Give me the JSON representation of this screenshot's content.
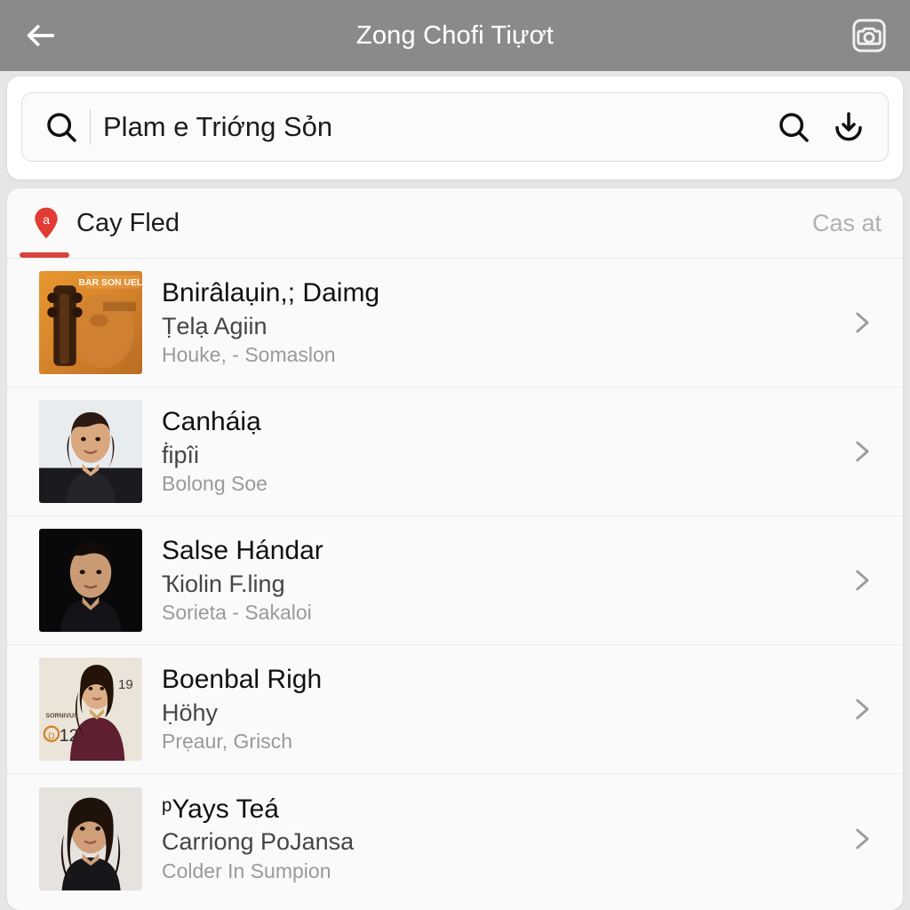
{
  "appbar": {
    "title": "Zong Chofi Tiựơt",
    "back_icon": "arrow-left-icon",
    "camera_icon": "camera-icon",
    "background_color": "#8a8a8a",
    "title_color": "#ffffff"
  },
  "search": {
    "value": "Plam e Triớng Sỏn",
    "placeholder": "Plam e Triớng Sỏn",
    "leading_icon": "search-icon",
    "trailing_icons": [
      "search-icon",
      "download-icon"
    ]
  },
  "tabs": {
    "active_icon": "location-pin-icon",
    "active_icon_color": "#e03b34",
    "active_label": "Cay Fled",
    "inactive_label": "Cas at",
    "underline_color": "#d8433c"
  },
  "results": [
    {
      "title": "Bnirâlaụin,; Daimg",
      "subtitle": "Ṭelạ Agiin",
      "meta": "Houke, - Somaslon",
      "thumb": "album-cover-violin",
      "thumb_label": "BAR SON UELL",
      "chevron_icon": "chevron-right-icon"
    },
    {
      "title": "Canháiạ",
      "subtitle": "ḟipîi",
      "meta": "Bolong Soe",
      "thumb": "portrait-woman-black-lace",
      "thumb_label": "",
      "chevron_icon": "chevron-right-icon"
    },
    {
      "title": "Salse Hándar",
      "subtitle": "Ҡiolin F.ling",
      "meta": "Sorieta - Sakaloi",
      "thumb": "portrait-man-dark",
      "thumb_label": "",
      "chevron_icon": "chevron-right-icon"
    },
    {
      "title": "Boenbal Righ",
      "subtitle": "Ḥöhy",
      "meta": "Prẹaur, Grisch",
      "thumb": "portrait-woman-maroon-dress",
      "thumb_label": "12",
      "thumb_badge_top": "19",
      "chevron_icon": "chevron-right-icon"
    },
    {
      "title": "ᵖYays Teá",
      "subtitle": "Carriong PoJansa",
      "meta": "Colder In Sumpion",
      "thumb": "portrait-woman-long-hair",
      "thumb_label": "",
      "chevron_icon": "chevron-right-icon"
    }
  ]
}
